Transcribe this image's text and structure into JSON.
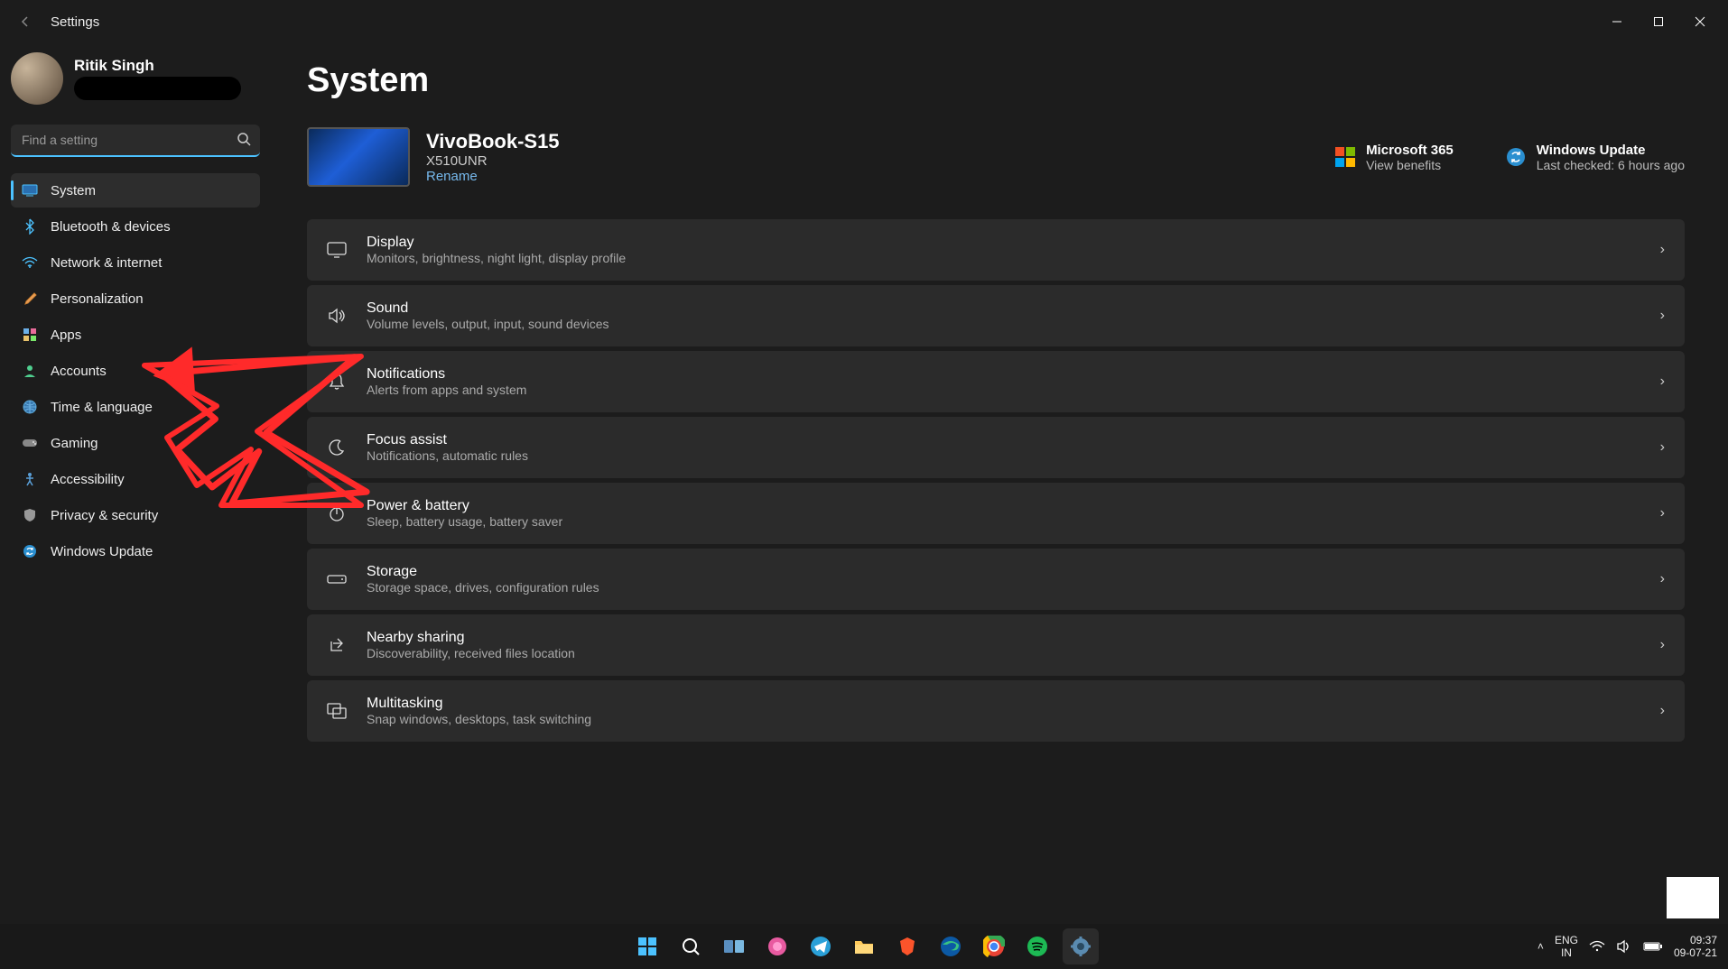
{
  "app": {
    "title": "Settings"
  },
  "profile": {
    "name": "Ritik Singh"
  },
  "search": {
    "placeholder": "Find a setting"
  },
  "sidebar": {
    "items": [
      {
        "label": "System"
      },
      {
        "label": "Bluetooth & devices"
      },
      {
        "label": "Network & internet"
      },
      {
        "label": "Personalization"
      },
      {
        "label": "Apps"
      },
      {
        "label": "Accounts"
      },
      {
        "label": "Time & language"
      },
      {
        "label": "Gaming"
      },
      {
        "label": "Accessibility"
      },
      {
        "label": "Privacy & security"
      },
      {
        "label": "Windows Update"
      }
    ]
  },
  "page": {
    "title": "System",
    "device": {
      "name": "VivoBook-S15",
      "model": "X510UNR",
      "rename": "Rename"
    },
    "m365": {
      "title": "Microsoft 365",
      "sub": "View benefits"
    },
    "update": {
      "title": "Windows Update",
      "sub": "Last checked: 6 hours ago"
    }
  },
  "cards": [
    {
      "title": "Display",
      "desc": "Monitors, brightness, night light, display profile"
    },
    {
      "title": "Sound",
      "desc": "Volume levels, output, input, sound devices"
    },
    {
      "title": "Notifications",
      "desc": "Alerts from apps and system"
    },
    {
      "title": "Focus assist",
      "desc": "Notifications, automatic rules"
    },
    {
      "title": "Power & battery",
      "desc": "Sleep, battery usage, battery saver"
    },
    {
      "title": "Storage",
      "desc": "Storage space, drives, configuration rules"
    },
    {
      "title": "Nearby sharing",
      "desc": "Discoverability, received files location"
    },
    {
      "title": "Multitasking",
      "desc": "Snap windows, desktops, task switching"
    }
  ],
  "taskbar": {
    "lang1": "ENG",
    "lang2": "IN",
    "time": "09:37",
    "date": "09-07-21"
  }
}
